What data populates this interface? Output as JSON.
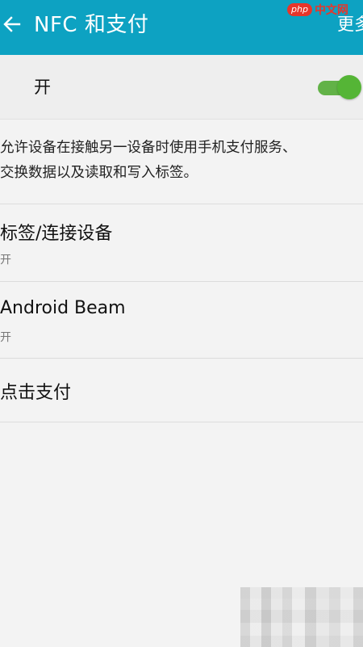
{
  "app_bar": {
    "title": "NFC 和支付",
    "more_label": "更多",
    "back_icon": "back-arrow-icon",
    "color": "#0da2c2"
  },
  "watermark": {
    "badge": "php",
    "text": "中文网"
  },
  "master_switch": {
    "label": "开",
    "state": "on",
    "color": "#55b536"
  },
  "description": {
    "line1": "允许设备在接触另一设备时使用手机支付服务、",
    "line2": "交换数据以及读取和写入标签。"
  },
  "items": [
    {
      "title": "标签/连接设备",
      "subtitle": "开"
    },
    {
      "title": "Android Beam",
      "subtitle": "开"
    },
    {
      "title": "点击支付",
      "subtitle": ""
    }
  ]
}
